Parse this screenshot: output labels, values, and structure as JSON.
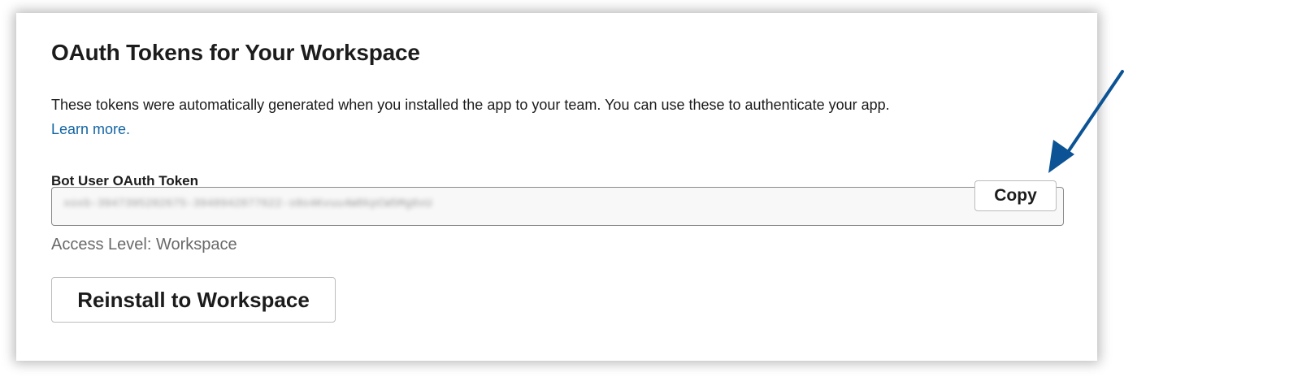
{
  "card": {
    "title": "OAuth Tokens for Your Workspace",
    "description": "These tokens were automatically generated when you installed the app to your team. You can use these to authenticate your app.",
    "learn_more": "Learn more."
  },
  "token_field": {
    "label": "Bot User OAuth Token",
    "masked_value": "xoxb-3947395202675-3948942877622-s0o4Kvuu4W8kpCW5Mg0xU",
    "copy_label": "Copy",
    "access_level": "Access Level: Workspace"
  },
  "actions": {
    "reinstall_label": "Reinstall to Workspace"
  },
  "annotation": {
    "arrow_color": "#0b5394",
    "arrow_icon": "arrow-pointer-icon"
  },
  "colors": {
    "link": "#1264a3",
    "text": "#1d1c1d",
    "muted": "#696969"
  }
}
